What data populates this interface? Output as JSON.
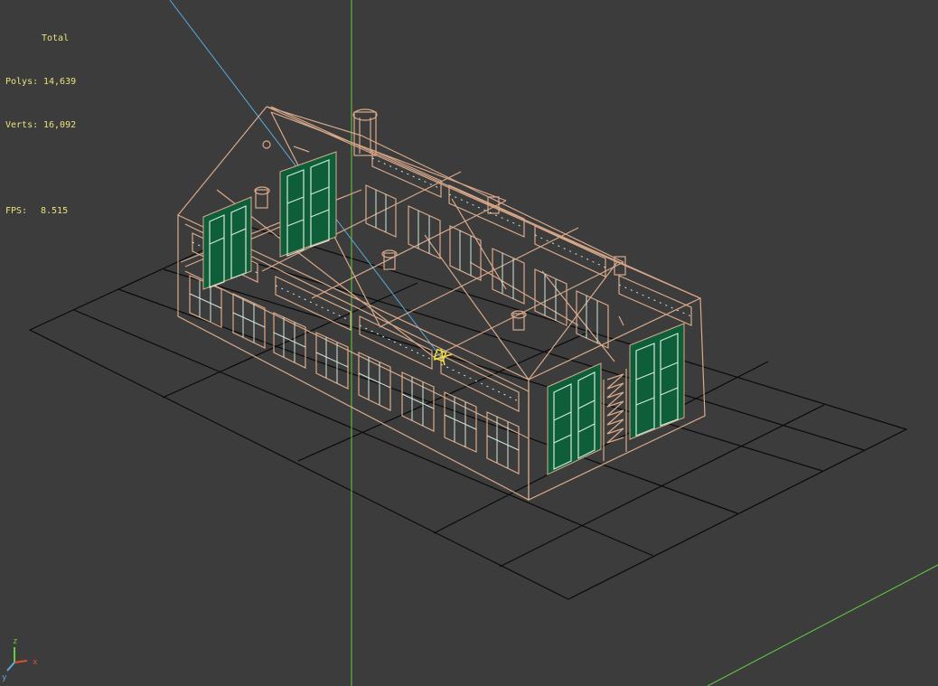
{
  "stats": {
    "total_label": "Total",
    "polys_label": "Polys:",
    "polys_value": "14,639",
    "verts_label": "Verts:",
    "verts_value": "16,092",
    "fps_label": "FPS:",
    "fps_value": "8.515"
  },
  "viewport": {
    "background": "#3c3c3c",
    "grid_color": "#0a0a0a",
    "wire_color": "#d9a98a",
    "glass_color": "#0e5e3a",
    "pane_color": "#cfe8d8",
    "axis_green": "#5fd040",
    "axis_blue": "#56aee0",
    "stats_color": "#e8e27a"
  },
  "gizmo": {
    "icon": "xyz-axis-icon"
  },
  "selection": {
    "icon": "pivot-marker-icon"
  }
}
